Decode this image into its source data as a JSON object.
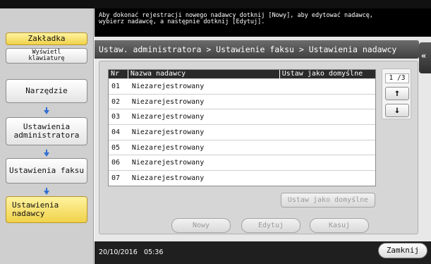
{
  "message": {
    "line1": "Aby dokonać rejestracji nowego nadawcy dotknij [Nowy], aby edytować nadawcę,",
    "line2": "wybierz nadawcę, a następnie dotknij [Edytuj]."
  },
  "left_panel": {
    "bookmark_label": "Zakładka",
    "keyboard_label_line1": "Wyświetl",
    "keyboard_label_line2": "klawiaturę",
    "tool_label": "Narzędzie",
    "admin_label_line1": "Ustawienia",
    "admin_label_line2": "administratora",
    "fax_label": "Ustawienia faksu",
    "sender_label_line1": "Ustawienia",
    "sender_label_line2": "nadawcy"
  },
  "breadcrumb": "Ustaw. administratora > Ustawienie faksu > Ustawienia nadawcy",
  "table": {
    "columns": [
      "Nr",
      "Nazwa nadawcy",
      "Ustaw jako domyślne"
    ],
    "rows": [
      {
        "nr": "01",
        "name": "Niezarejestrowany",
        "default": ""
      },
      {
        "nr": "02",
        "name": "Niezarejestrowany",
        "default": ""
      },
      {
        "nr": "03",
        "name": "Niezarejestrowany",
        "default": ""
      },
      {
        "nr": "04",
        "name": "Niezarejestrowany",
        "default": ""
      },
      {
        "nr": "05",
        "name": "Niezarejestrowany",
        "default": ""
      },
      {
        "nr": "06",
        "name": "Niezarejestrowany",
        "default": ""
      },
      {
        "nr": "07",
        "name": "Niezarejestrowany",
        "default": ""
      }
    ]
  },
  "pager": {
    "page_indicator": "1 /3",
    "up_icon": "up-arrow-icon",
    "down_icon": "down-arrow-icon"
  },
  "buttons": {
    "set_default": "Ustaw jako domyślne",
    "new": "Nowy",
    "edit": "Edytuj",
    "delete": "Kasuj",
    "close": "Zamknij"
  },
  "status": {
    "date": "20/10/2016",
    "time": "05:36"
  },
  "colors": {
    "accent_yellow": "#f0d24a",
    "arrow_blue": "#2f6fd0",
    "header_dark": "#2a2a2a"
  }
}
